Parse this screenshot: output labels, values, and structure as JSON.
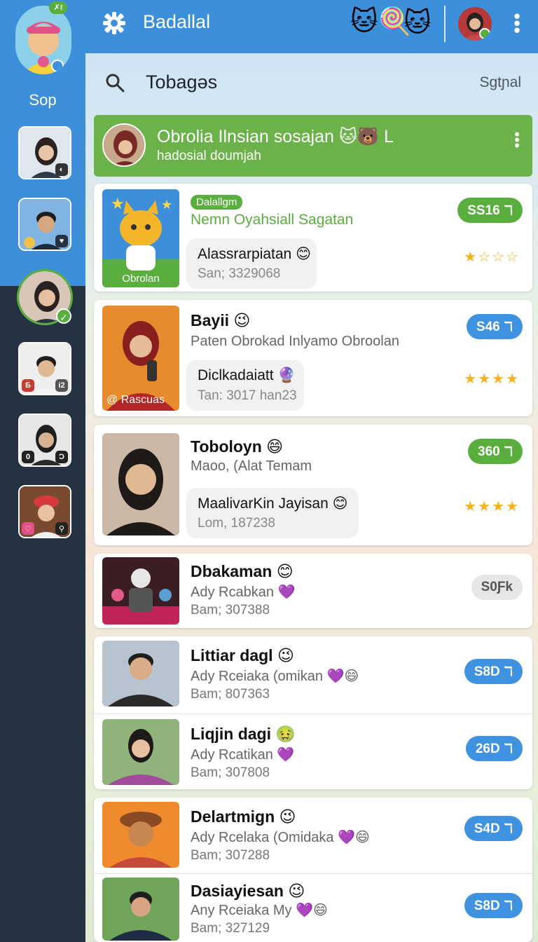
{
  "colors": {
    "accent": "#3e8fd9",
    "green": "#6bb24a",
    "pill_green": "#5aae3e",
    "pill_blue": "#3e92e0",
    "pill_gray": "#e6e6e6"
  },
  "rail": {
    "label": "Sop"
  },
  "appbar": {
    "title": "Badallal"
  },
  "search": {
    "query": "Tobagəs",
    "right_label": "Sgtɲal"
  },
  "banner": {
    "title": "Obrolia Ilnsian sosajan 🐱🐻 L",
    "subtitle": "hadosial doumjah"
  },
  "cards": [
    {
      "tag": "Dalallgm",
      "title": "Nemn Oyahsiall Sagatan",
      "pill": "SS16 ℸ",
      "bubble_title": "Alassrarpiatan 😊",
      "bubble_sub": "San; 3329068",
      "thumb_label": "Obrolan",
      "stars": "★☆☆☆"
    },
    {
      "name": "Bayii 😉",
      "line1": "Paten Obrokad Inlyamo Obroolan",
      "pill": "S46 ℸ",
      "bubble_title": "Diclkadaiatt 🔮",
      "bubble_sub": "Tan: 3017 han23",
      "thumb_label": "@ Rascuas",
      "stars": "★★★★"
    },
    {
      "name": "Toboloyn 😄",
      "line1": "Maoo, (Alat Temam",
      "pill": "360 ℸ",
      "bubble_title": "MaalivarKin Jayisan 😊",
      "bubble_sub": "Lom, 187238",
      "stars": "★★★★"
    },
    {
      "name": "Dbakaman 😊",
      "line1": "Ady Rcabkan 💜",
      "line2": "Bam; 307388",
      "pill": "S0Ƒk"
    },
    {
      "name": "Littiar dagl 😉",
      "line1": "Ady Rceiaka (omikan 💜😄",
      "line2": "Bam; 807363",
      "pill": "S8D ℸ"
    },
    {
      "name": "Liqjin dagi 🤢",
      "line1": "Ady Rcatikan 💜",
      "line2": "Bam; 307808",
      "pill": "26D ℸ"
    },
    {
      "name": "Delartmign 😉",
      "line1": "Ady Rcelaka (Omidaka 💜😄",
      "line2": "Bam; 307288",
      "pill": "S4D ℸ"
    },
    {
      "name": "Dasiayiesan 😉",
      "line1": "Any Rceiaka My 💜😄",
      "line2": "Bam; 327129",
      "pill": "S8D ℸ"
    }
  ]
}
